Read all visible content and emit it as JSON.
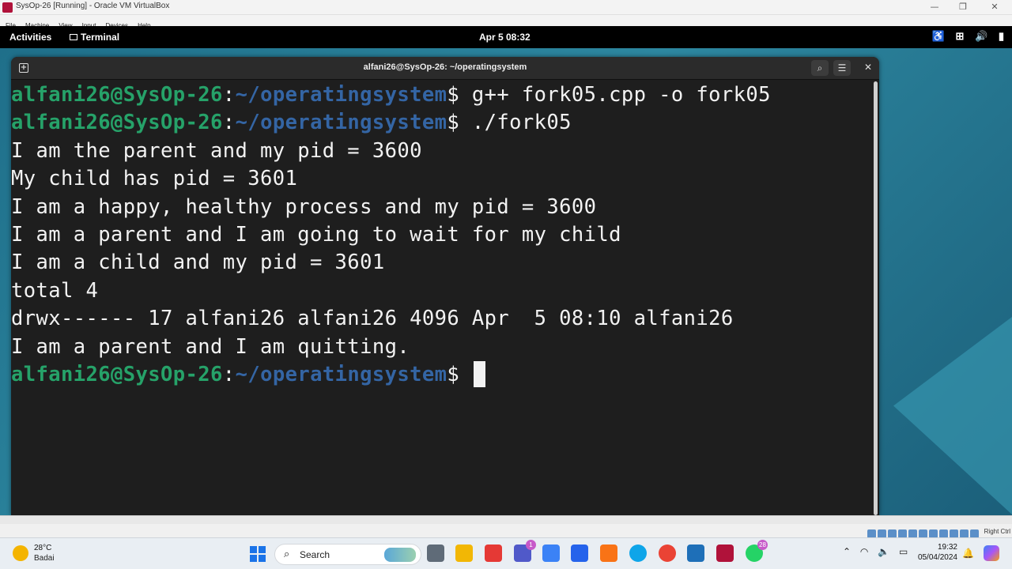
{
  "vbox": {
    "title": "SysOp-26 [Running] - Oracle VM VirtualBox",
    "menu": [
      "File",
      "Machine",
      "View",
      "Input",
      "Devices",
      "Help"
    ],
    "controls": {
      "minimize": "—",
      "restore": "❐",
      "close": "✕"
    },
    "host_key": "Right Ctrl"
  },
  "gnome": {
    "activities": "Activities",
    "app_name": "Terminal",
    "clock": "Apr 5  08:32",
    "tray_icons": [
      "accessibility-icon",
      "network-icon",
      "volume-icon",
      "battery-icon"
    ]
  },
  "terminal": {
    "title": "alfani26@SysOp-26: ~/operatingsystem",
    "prompt_user": "alfani26@SysOp-26",
    "prompt_sep": ":",
    "prompt_path": "~/operatingsystem",
    "prompt_symbol": "$ ",
    "commands": [
      "g++ fork05.cpp -o fork05",
      "./fork05"
    ],
    "output": [
      "I am the parent and my pid = 3600",
      "My child has pid = 3601",
      "I am a happy, healthy process and my pid = 3600",
      "I am a parent and I am going to wait for my child",
      "I am a child and my pid = 3601",
      "total 4",
      "drwx------ 17 alfani26 alfani26 4096 Apr  5 08:10 alfani26",
      "I am a parent and I am quitting."
    ],
    "header_buttons": {
      "search": "⌕",
      "menu": "☰",
      "close": "✕",
      "new_tab": "+"
    }
  },
  "taskbar": {
    "weather_temp": "28°C",
    "weather_cond": "Badai",
    "search_label": "Search",
    "time": "19:32",
    "date": "05/04/2024",
    "badges": {
      "teams": "1",
      "whatsapp": "28"
    },
    "colors": {
      "accent": "#1a73e8"
    }
  }
}
